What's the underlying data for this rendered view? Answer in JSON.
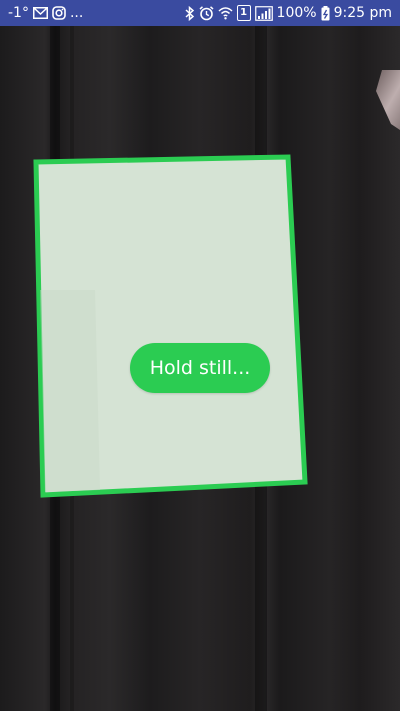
{
  "status_bar": {
    "temperature": "-1°",
    "overflow_indicator": "...",
    "sim_label": "1",
    "battery": "100%",
    "time": "9:25 pm",
    "background_color": "#3a4ba0"
  },
  "scanner": {
    "message": "Hold still...",
    "border_color": "#2bcc52",
    "document_fill": "#d5e3d4"
  },
  "icons": {
    "left": [
      "gmail-icon",
      "instagram-icon"
    ],
    "right": [
      "bluetooth-icon",
      "alarm-icon",
      "wifi-icon",
      "sim-icon",
      "signal-icon",
      "battery-icon"
    ]
  }
}
